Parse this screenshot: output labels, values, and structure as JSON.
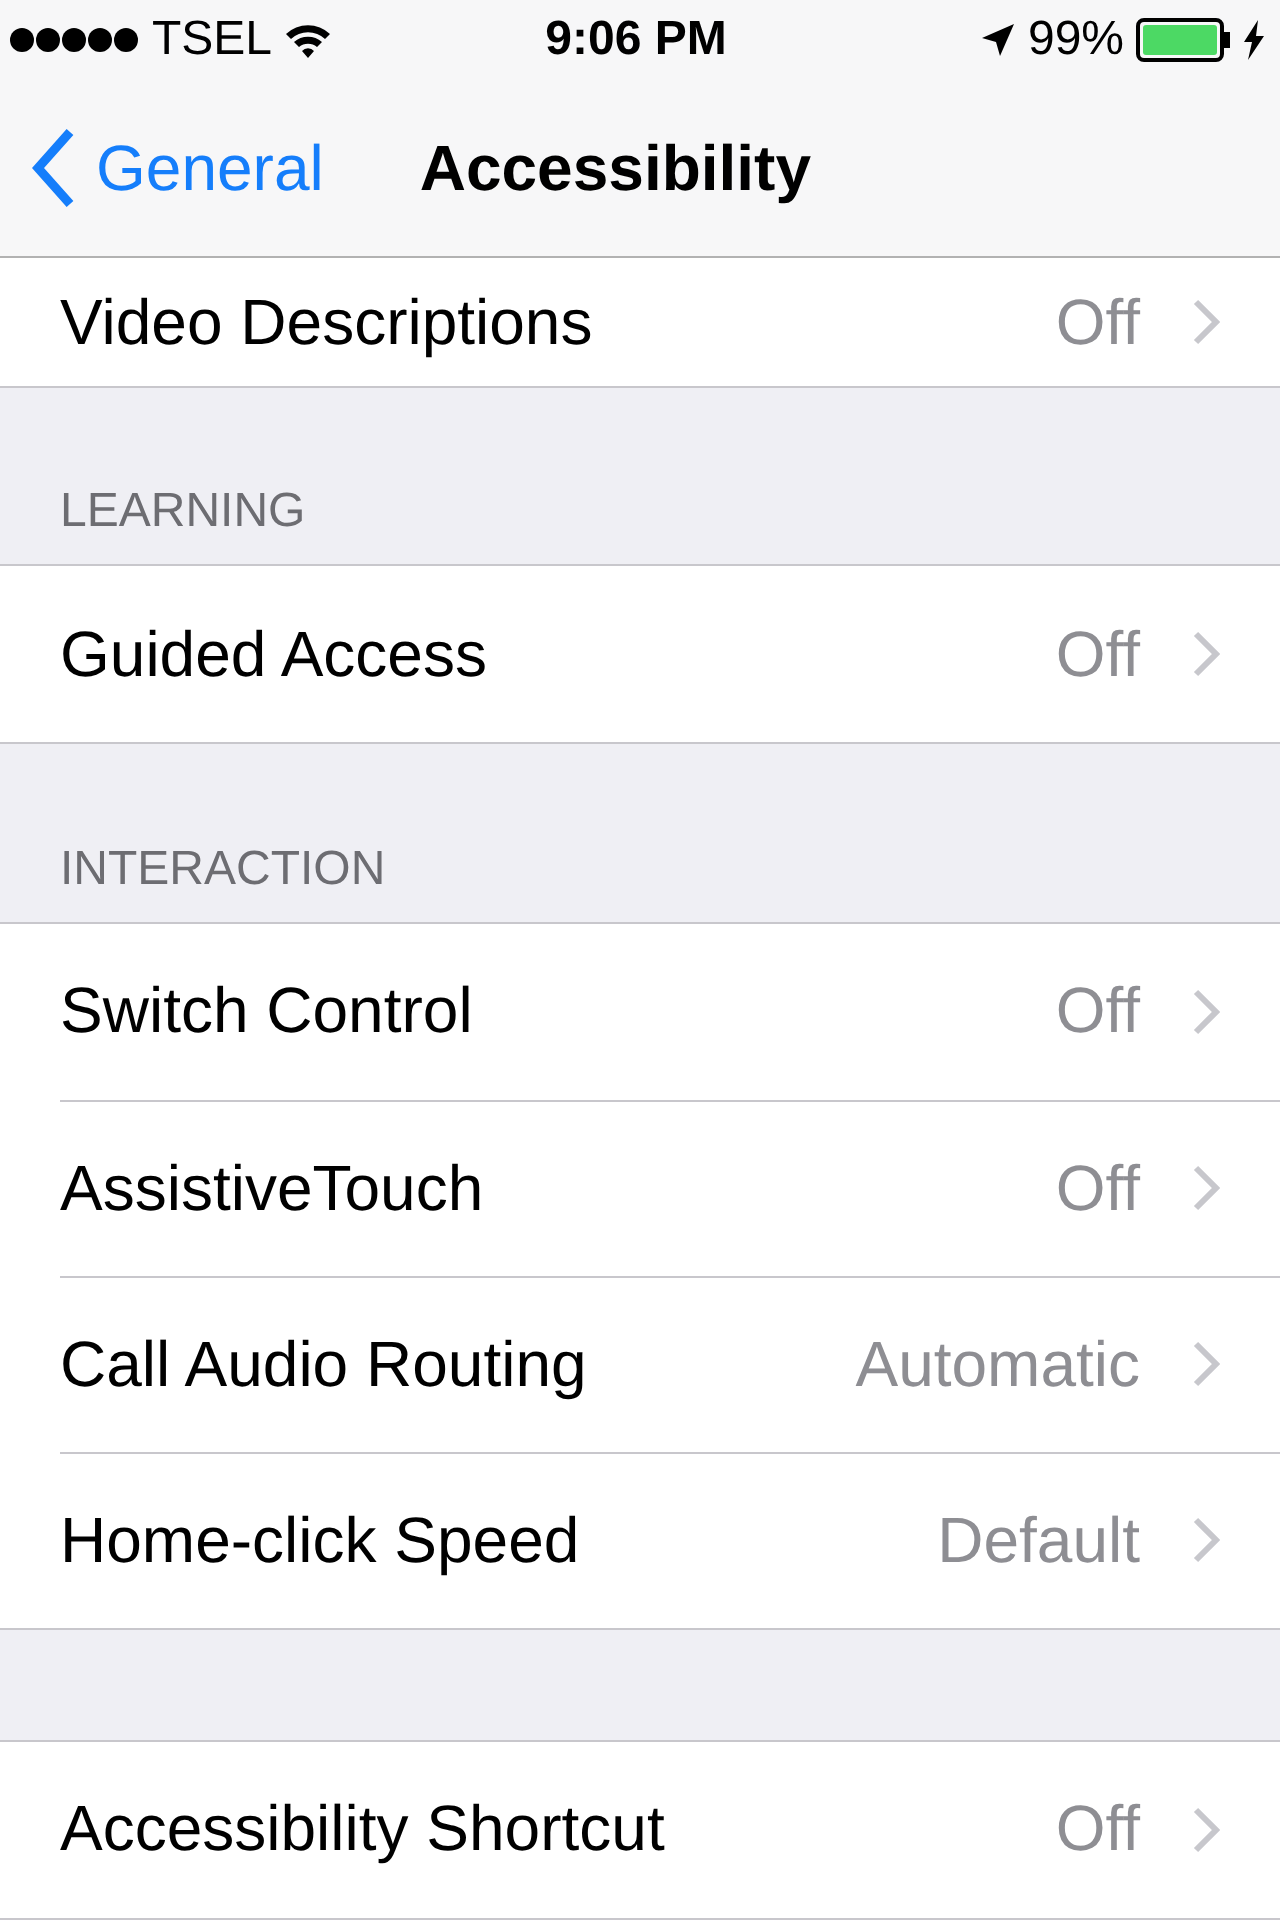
{
  "status_bar": {
    "carrier": "TSEL",
    "time": "9:06 PM",
    "battery": "99%"
  },
  "nav": {
    "back": "General",
    "title": "Accessibility"
  },
  "sections": [
    {
      "rows": [
        {
          "label": "Video Descriptions",
          "value": "Off"
        }
      ]
    },
    {
      "header": "LEARNING",
      "rows": [
        {
          "label": "Guided Access",
          "value": "Off"
        }
      ]
    },
    {
      "header": "INTERACTION",
      "rows": [
        {
          "label": "Switch Control",
          "value": "Off"
        },
        {
          "label": "AssistiveTouch",
          "value": "Off"
        },
        {
          "label": "Call Audio Routing",
          "value": "Automatic"
        },
        {
          "label": "Home-click Speed",
          "value": "Default"
        }
      ]
    },
    {
      "rows": [
        {
          "label": "Accessibility Shortcut",
          "value": "Off"
        }
      ]
    }
  ]
}
